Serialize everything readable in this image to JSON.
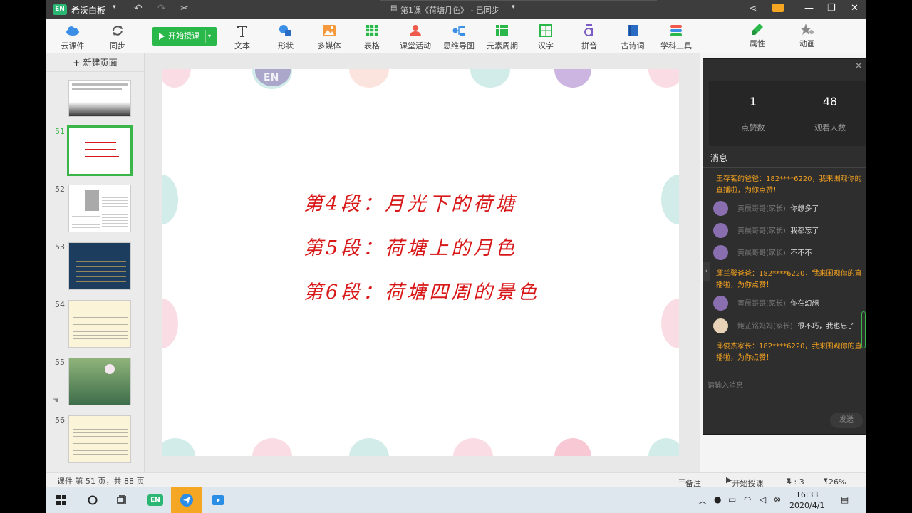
{
  "window": {
    "app_name": "希沃白板",
    "doc_title": "第1课《荷塘月色》 - 已同步",
    "dropdown_caret": "▾"
  },
  "toolbar": {
    "cloud": "云课件",
    "sync": "同步",
    "start_class": "开始授课",
    "tools": [
      "文本",
      "形状",
      "多媒体",
      "表格",
      "课堂活动",
      "思维导图",
      "元素周期",
      "汉字",
      "拼音",
      "古诗词",
      "学科工具"
    ],
    "properties": "属性",
    "animation": "动画"
  },
  "sidebar": {
    "new_page": "新建页面",
    "pages": [
      {
        "num": ""
      },
      {
        "num": "51"
      },
      {
        "num": "52"
      },
      {
        "num": "53"
      },
      {
        "num": "54"
      },
      {
        "num": "55"
      },
      {
        "num": "56"
      }
    ]
  },
  "slide": {
    "lines": [
      "第4段：月光下的荷塘",
      "第5段：荷塘上的月色",
      "第6段：荷塘四周的景色"
    ],
    "watermark": "EN"
  },
  "chat": {
    "likes": "1",
    "likes_label": "点赞数",
    "viewers": "48",
    "viewers_label": "观看人数",
    "messages_title": "消息",
    "messages": [
      {
        "type": "sys",
        "text": "王存茗的爸爸：182****6220，我来围观你的直播啦，为你点赞！"
      },
      {
        "type": "user",
        "name": "黄晨哥哥(家长):",
        "text": "你想多了"
      },
      {
        "type": "user",
        "name": "黄晨哥哥(家长):",
        "text": "我都忘了"
      },
      {
        "type": "user",
        "name": "黄晨哥哥(家长):",
        "text": "不不不"
      },
      {
        "type": "sys",
        "text": "邱兰馨爸爸：182****6220，我来围观你的直播啦，为你点赞！"
      },
      {
        "type": "user",
        "name": "黄晨哥哥(家长):",
        "text": "你在幻想"
      },
      {
        "type": "user",
        "name": "鲍芷铭妈妈(家长):",
        "text": "很不巧，我也忘了"
      },
      {
        "type": "sys",
        "text": "邱俊杰家长：182****6220，我来围观你的直播啦，为你点赞！"
      }
    ],
    "input_placeholder": "请输入消息",
    "send": "发送"
  },
  "statusbar": {
    "page_info": "课件 第 51 页，共 88 页",
    "notes": "备注",
    "start": "开始授课",
    "ratio": "4 : 3",
    "zoom": "126%"
  },
  "taskbar": {
    "time": "16:33",
    "date": "2020/4/1"
  }
}
